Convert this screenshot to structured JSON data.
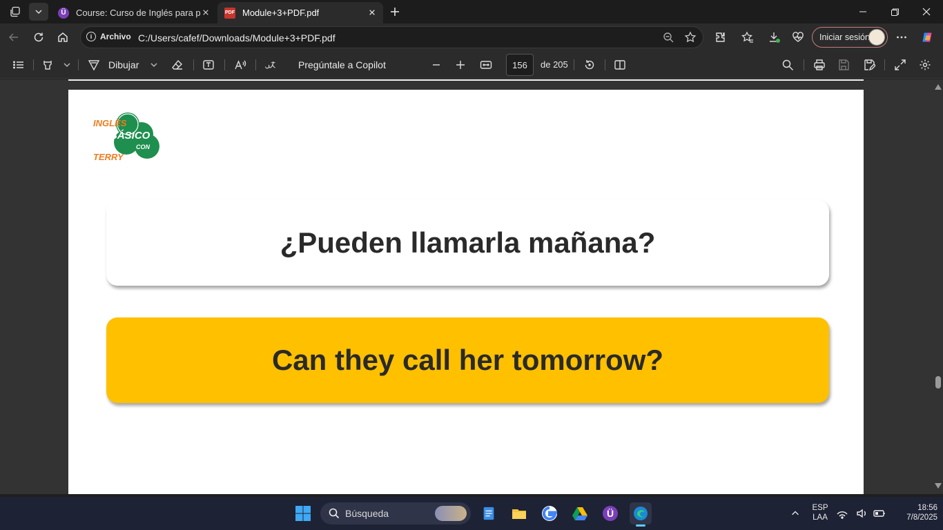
{
  "browser": {
    "tabs": [
      {
        "title": "Course: Curso de Inglés para principiantes",
        "favicon": "udemy-u"
      },
      {
        "title": "Module+3+PDF.pdf",
        "favicon": "pdf"
      }
    ],
    "address": {
      "site_info_label": "Archivo",
      "url": "C:/Users/cafef/Downloads/Module+3+PDF.pdf"
    },
    "signin_label": "Iniciar sesión"
  },
  "pdf_toolbar": {
    "draw_label": "Dibujar",
    "copilot_label": "Pregúntale a Copilot",
    "current_page": "156",
    "total_pages_label": "de 205"
  },
  "document": {
    "logo": {
      "line1": "INGLÉS",
      "line2": "BÁSICO",
      "line3": "CON",
      "line4": "TERRY"
    },
    "question_es": "¿Pueden llamarla mañana?",
    "answer_en": "Can they call her tomorrow?"
  },
  "taskbar": {
    "search_placeholder": "Búsqueda",
    "language": "ESP",
    "layout": "LAA",
    "time": "18:56",
    "date": "7/8/2025"
  },
  "colors": {
    "answer_card": "#ffc000",
    "logo_green": "#1e8f4e",
    "logo_orange": "#f07c1e"
  }
}
